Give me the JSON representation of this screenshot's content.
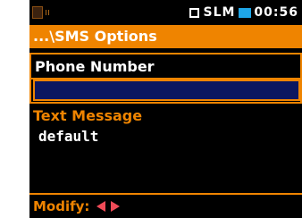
{
  "status": {
    "mode": "SLM",
    "time": "00:56",
    "icons": [
      "sd-card-icon",
      "signal-icon",
      "mode-box-icon",
      "battery-icon"
    ]
  },
  "title": "...\\SMS Options",
  "items": [
    {
      "label": "Phone Number",
      "value": ""
    },
    {
      "label": "Text Message",
      "value": "default"
    }
  ],
  "footer": {
    "label": "Modify:",
    "icons": [
      "arrow-left-icon",
      "arrow-right-icon"
    ]
  },
  "colors": {
    "accent": "#ef8400",
    "selection_fill": "#0c1760",
    "arrows": "#ef4b57",
    "battery": "#1ea6e8"
  }
}
